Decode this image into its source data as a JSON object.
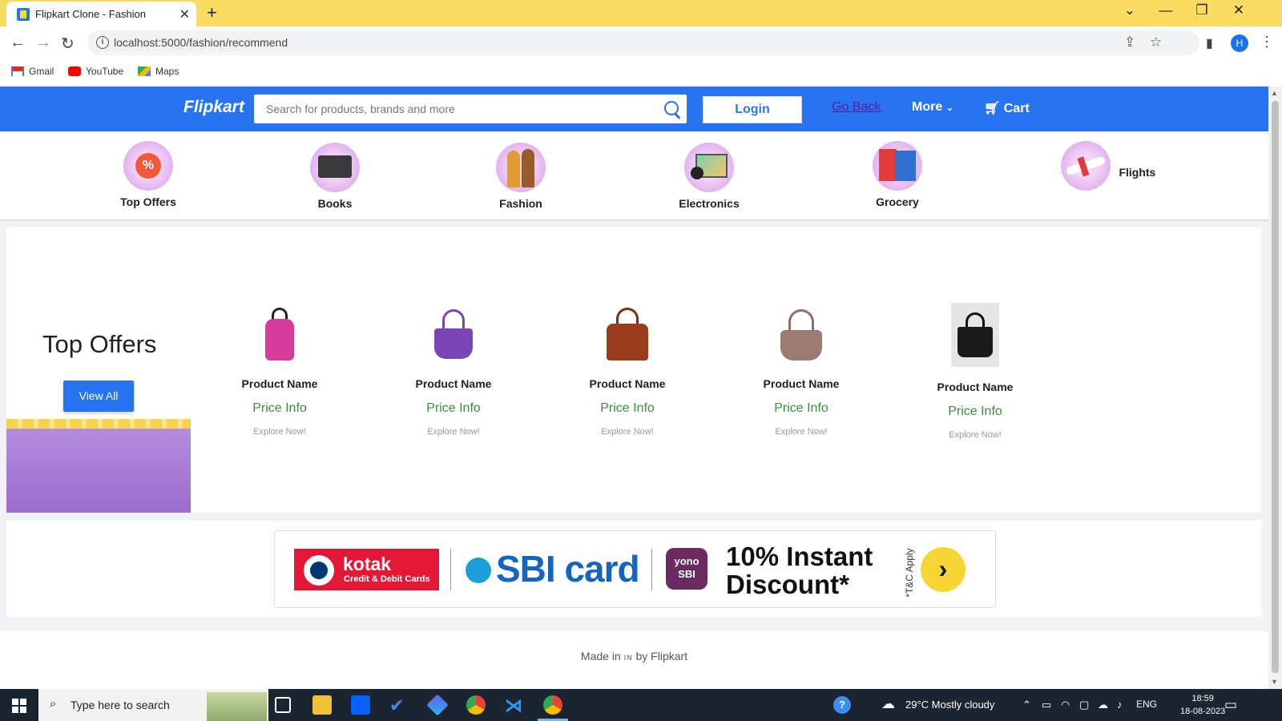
{
  "browser": {
    "tab_title": "Flipkart Clone - Fashion",
    "url": "localhost:5000/fashion/recommend",
    "profile_initial": "H",
    "bookmarks": [
      {
        "label": "Gmail",
        "icon": "gmail-icon"
      },
      {
        "label": "YouTube",
        "icon": "youtube-icon"
      },
      {
        "label": "Maps",
        "icon": "maps-icon"
      }
    ]
  },
  "header": {
    "logo": "Flipkart",
    "search_placeholder": "Search for products, brands and more",
    "login_label": "Login",
    "go_back_label": "Go Back",
    "more_label": "More",
    "cart_label": "Cart"
  },
  "categories": [
    {
      "label": "Top Offers"
    },
    {
      "label": "Books"
    },
    {
      "label": "Fashion"
    },
    {
      "label": "Electronics"
    },
    {
      "label": "Grocery"
    },
    {
      "label": "Flights"
    }
  ],
  "offers": {
    "title": "Top Offers",
    "view_all_label": "View All",
    "products": [
      {
        "name": "Product Name",
        "price": "Price Info",
        "explore": "Explore Now!",
        "color": "#d63d9b"
      },
      {
        "name": "Product Name",
        "price": "Price Info",
        "explore": "Explore Now!",
        "color": "#7b45b5"
      },
      {
        "name": "Product Name",
        "price": "Price Info",
        "explore": "Explore Now!",
        "color": "#9a3d1f"
      },
      {
        "name": "Product Name",
        "price": "Price Info",
        "explore": "Explore Now!",
        "color": "#9b7b73"
      },
      {
        "name": "Product Name",
        "price": "Price Info",
        "explore": "Explore Now!",
        "color": "#1a1a1a"
      }
    ]
  },
  "banner": {
    "kotak_name": "kotak",
    "kotak_sub": "Credit & Debit Cards",
    "sbi_text": "SBI card",
    "yono_line1": "yono",
    "yono_line2": "SBI",
    "discount_line1": "10% Instant",
    "discount_line2": "Discount*",
    "tnc": "*T&C Apply"
  },
  "footer": {
    "made_in": "Made in",
    "country": "IN",
    "by": "by Flipkart"
  },
  "taskbar": {
    "search_placeholder": "Type here to search",
    "weather": "29°C  Mostly cloudy",
    "language": "ENG",
    "time": "18:59",
    "date": "18-08-2023"
  },
  "colors": {
    "brand_blue": "#2874f0",
    "price_green": "#388e3c",
    "tabstrip_yellow": "#fbdc62"
  }
}
